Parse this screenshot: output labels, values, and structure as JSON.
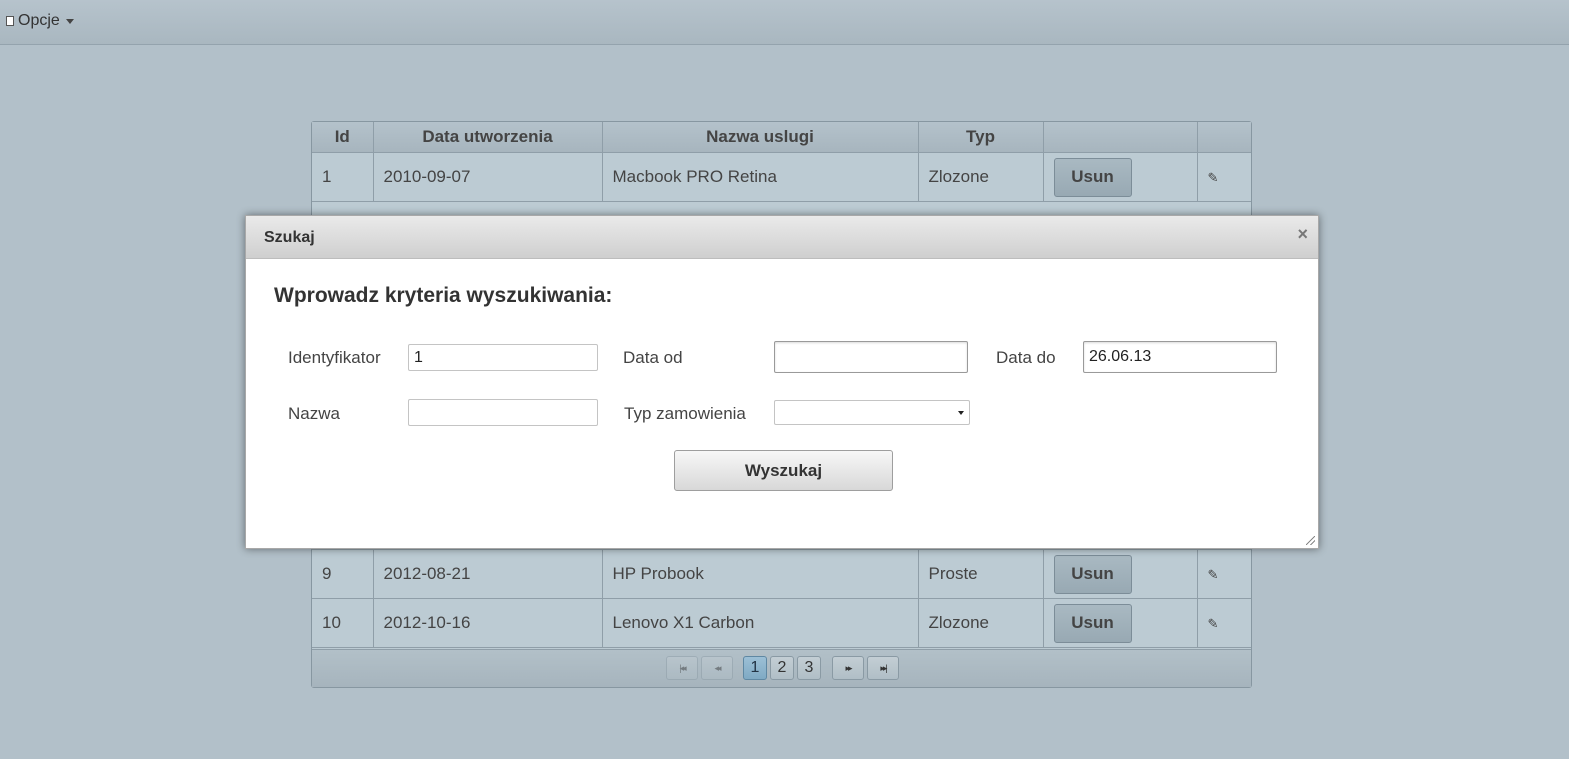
{
  "menubar": {
    "options_label": "Opcje"
  },
  "table": {
    "headers": [
      "Id",
      "Data utworzenia",
      "Nazwa uslugi",
      "Typ",
      "",
      ""
    ],
    "rows_top": [
      {
        "id": "1",
        "date": "2010-09-07",
        "name": "Macbook PRO Retina",
        "type": "Zlozone",
        "action": "Usun"
      }
    ],
    "rows_bottom": [
      {
        "id": "9",
        "date": "2012-08-21",
        "name": "HP Probook",
        "type": "Proste",
        "action": "Usun"
      },
      {
        "id": "10",
        "date": "2012-10-16",
        "name": "Lenovo X1 Carbon",
        "type": "Zlozone",
        "action": "Usun"
      }
    ]
  },
  "paginator": {
    "first": "|◂◂",
    "prev": "◂◂",
    "pages": [
      "1",
      "2",
      "3"
    ],
    "current_page": "1",
    "next": "▸▸",
    "last": "▸▸|"
  },
  "dialog": {
    "title": "Szukaj",
    "close": "×",
    "heading": "Wprowadz kryteria wyszukiwania:",
    "fields": {
      "id_label": "Identyfikator",
      "id_value": "1",
      "date_from_label": "Data od",
      "date_from_value": "",
      "date_to_label": "Data do",
      "date_to_value": "26.06.13",
      "name_label": "Nazwa",
      "name_value": "",
      "order_type_label": "Typ zamowienia",
      "order_type_value": ""
    },
    "search_button": "Wyszukaj"
  }
}
